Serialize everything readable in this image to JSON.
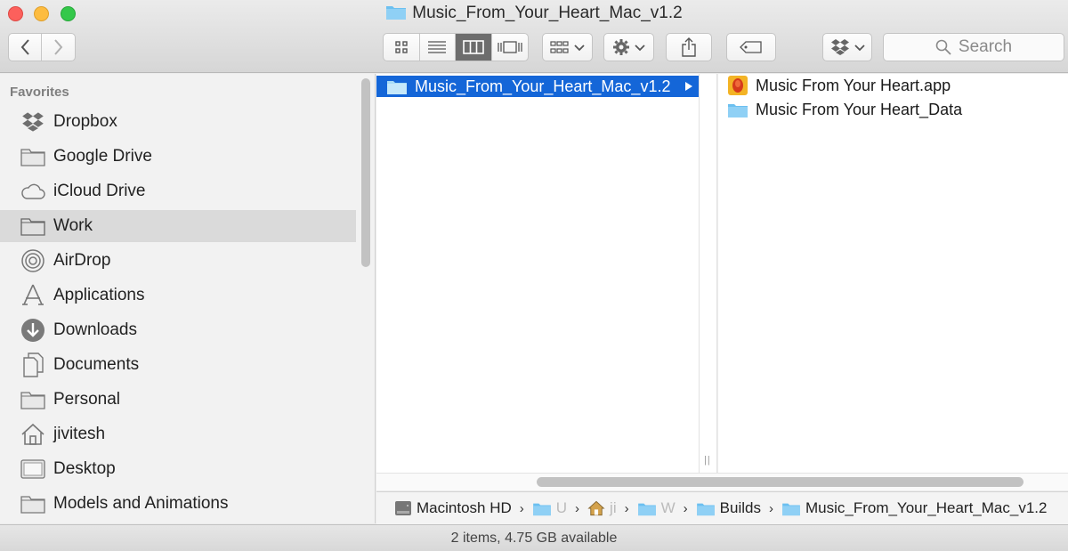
{
  "window": {
    "title": "Music_From_Your_Heart_Mac_v1.2"
  },
  "toolbar": {
    "back_icon": "chevron-left-icon",
    "forward_icon": "chevron-right-icon",
    "view_modes": [
      "icon-view",
      "list-view",
      "column-view",
      "cover-flow-view"
    ],
    "active_view": "column-view",
    "search_placeholder": "Search"
  },
  "sidebar": {
    "section_title": "Favorites",
    "items": [
      {
        "label": "Dropbox",
        "icon": "dropbox-icon"
      },
      {
        "label": "Google Drive",
        "icon": "folder-icon"
      },
      {
        "label": "iCloud Drive",
        "icon": "cloud-icon"
      },
      {
        "label": "Work",
        "icon": "folder-icon",
        "selected": true
      },
      {
        "label": "AirDrop",
        "icon": "airdrop-icon"
      },
      {
        "label": "Applications",
        "icon": "applications-icon"
      },
      {
        "label": "Downloads",
        "icon": "download-icon"
      },
      {
        "label": "Documents",
        "icon": "documents-icon"
      },
      {
        "label": "Personal",
        "icon": "folder-icon"
      },
      {
        "label": "jivitesh",
        "icon": "home-icon"
      },
      {
        "label": "Desktop",
        "icon": "desktop-icon"
      },
      {
        "label": "Models and Animations",
        "icon": "folder-icon"
      }
    ]
  },
  "columns": {
    "first": {
      "selected_item": "Music_From_Your_Heart_Mac_v1.2"
    },
    "second": {
      "items": [
        {
          "label": "Music From Your Heart.app",
          "icon": "app-icon"
        },
        {
          "label": "Music From Your Heart_Data",
          "icon": "folder-icon"
        }
      ]
    }
  },
  "pathbar": {
    "crumbs": [
      {
        "label": "Macintosh HD",
        "icon": "hard-drive-icon"
      },
      {
        "label": "U",
        "icon": "folder-icon",
        "faded": true
      },
      {
        "label": "ji",
        "icon": "home-icon",
        "faded": true
      },
      {
        "label": "W",
        "icon": "folder-icon",
        "faded": true
      },
      {
        "label": "Builds",
        "icon": "folder-icon"
      },
      {
        "label": "Music_From_Your_Heart_Mac_v1.2",
        "icon": "folder-icon"
      }
    ]
  },
  "status": {
    "text": "2 items, 4.75 GB available"
  },
  "colors": {
    "selection": "#1466d8",
    "folder": "#6cc0f0",
    "sidebar_selected": "#dadada"
  }
}
